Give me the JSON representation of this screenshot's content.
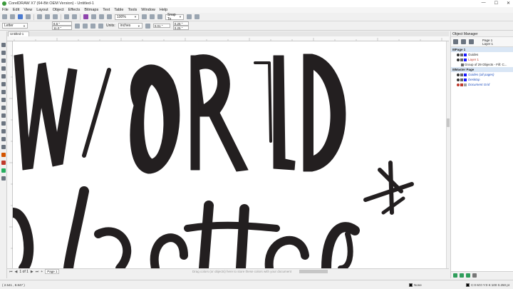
{
  "window": {
    "title": "CorelDRAW X7 (64-Bit OEM Version) - Untitled-1",
    "controls": [
      "—",
      "☐",
      "✕"
    ]
  },
  "menu": [
    "File",
    "Edit",
    "View",
    "Layout",
    "Object",
    "Effects",
    "Bitmaps",
    "Text",
    "Table",
    "Tools",
    "Window",
    "Help"
  ],
  "toolbar": {
    "zoom": "100%",
    "snap_to": "Snap To"
  },
  "property_bar": {
    "page_size": "Letter",
    "width": "8.5 \"",
    "height": "11.0 \"",
    "units_label": "Units:",
    "units_value": "inches",
    "nudge": "0.01 \"",
    "dup_x": "0.25 \"",
    "dup_y": "0.25 \""
  },
  "document_tab": "Untitled-1",
  "page_nav": {
    "page_of": "1 of 1",
    "page_tab": "Page 1",
    "drag_hint": "Drag colors (or objects) here to store these colors with your document"
  },
  "status": {
    "coords": "( 2.541 , 8.847 )",
    "fill_info": "C:0 M:0 Y:0 K:100  0.250 pt",
    "outline": "None"
  },
  "object_manager": {
    "title": "Object Manager",
    "page_info": [
      "Page 1",
      "Layer 1"
    ],
    "rows": [
      {
        "label": "Page 1",
        "type": "page"
      },
      {
        "label": "Guides",
        "type": "layer",
        "color": "#1a1aff"
      },
      {
        "label": "Layer 1",
        "type": "layer-active",
        "color": "#1a1aff"
      },
      {
        "label": "Group of 29 Objects - Fill: C...",
        "type": "object"
      },
      {
        "label": "Master Page",
        "type": "page"
      },
      {
        "label": "Guides (all pages)",
        "type": "master",
        "color": "#1a1aff"
      },
      {
        "label": "Desktop",
        "type": "master",
        "color": "#1a1aff"
      },
      {
        "label": "Document Grid",
        "type": "master",
        "color": "#a0a0a0"
      }
    ]
  },
  "canvas": {
    "fill_color": "#231f20"
  }
}
